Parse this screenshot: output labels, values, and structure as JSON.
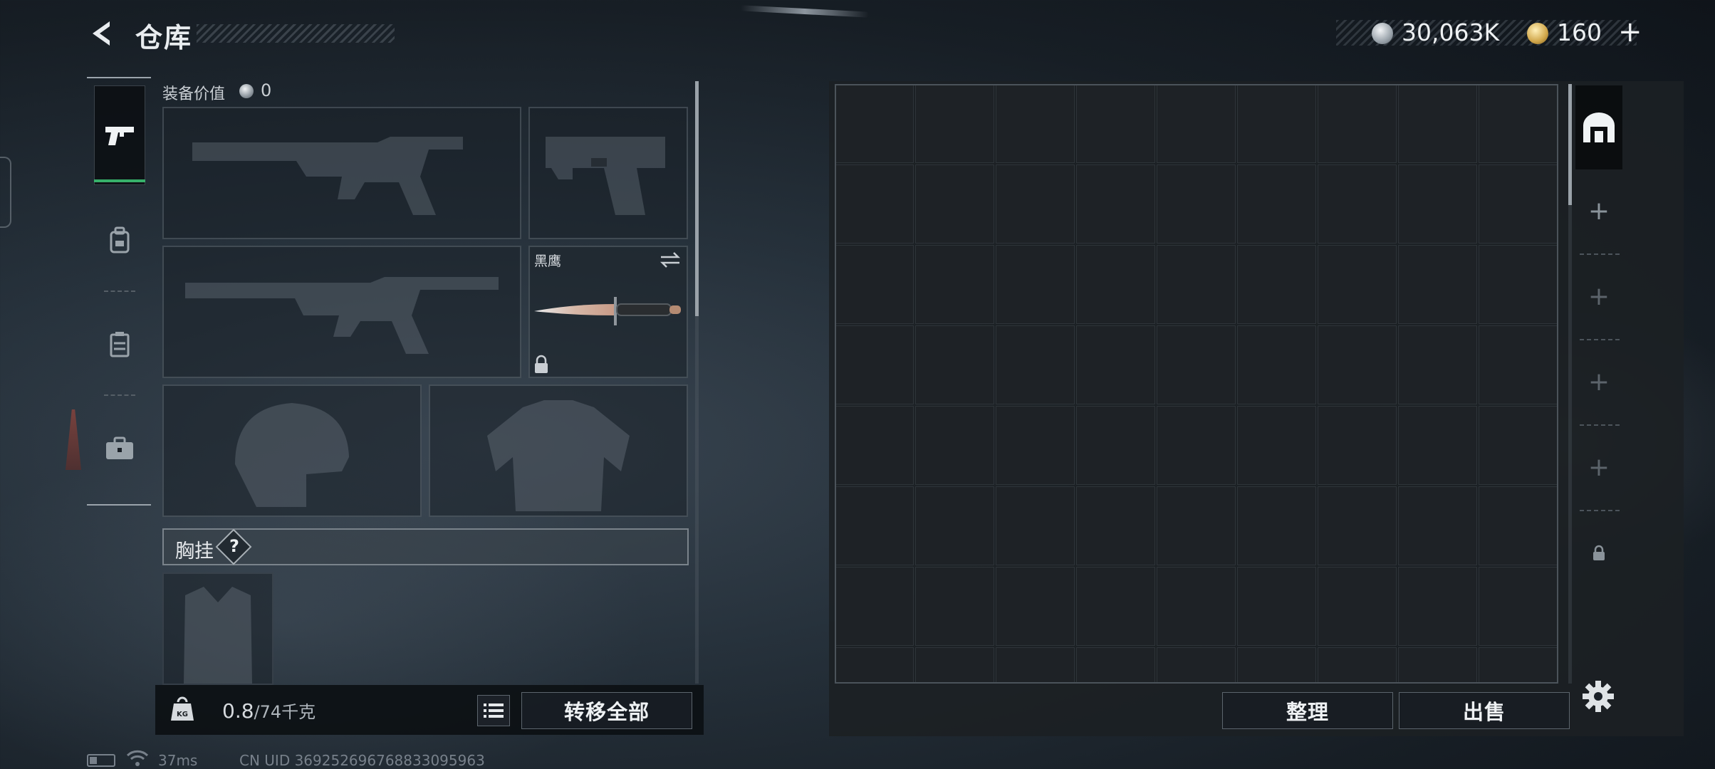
{
  "header": {
    "title": "仓库",
    "currency": {
      "silver_value": "30,063K",
      "gold_value": "160",
      "plus_label": "+"
    }
  },
  "equipment": {
    "value_label": "装备价值",
    "value": "0",
    "knife_name": "黑鹰",
    "chest_rig_label": "胸挂",
    "help_label": "?"
  },
  "bottom_bar": {
    "weight_current": "0.8",
    "weight_max": "/74千克",
    "kg_label": "KG",
    "transfer_all_label": "转移全部"
  },
  "storage": {
    "columns": 9,
    "visible_rows": 8,
    "tidy_label": "整理",
    "sell_label": "出售"
  },
  "status_bar": {
    "ping": "37ms",
    "uid": "CN UID 369252696768833095963"
  },
  "colors": {
    "accent_green": "#37b06a",
    "panel_dark": "#1e2226"
  }
}
